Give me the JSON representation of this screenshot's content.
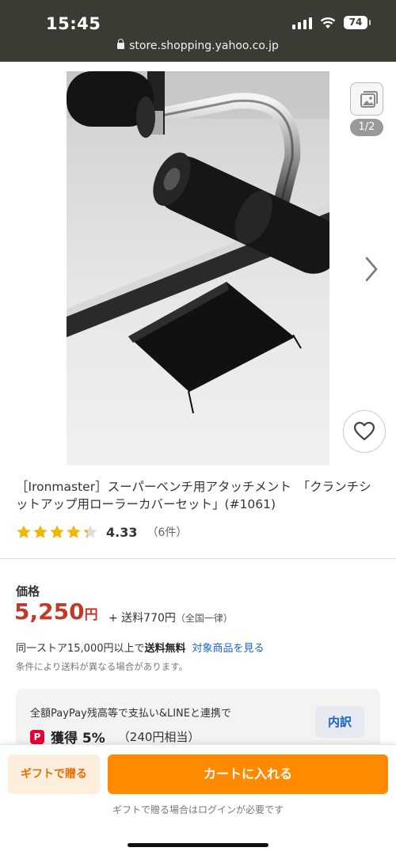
{
  "status": {
    "time": "15:45",
    "battery": "74"
  },
  "browser": {
    "url": "store.shopping.yahoo.co.jp"
  },
  "gallery": {
    "counter": "1/2"
  },
  "product": {
    "title": "［Ironmaster］スーパーベンチ用アタッチメント　「クランチシットアップ用ローラーカバーセット」(#1061)",
    "rating": {
      "score": "4.33",
      "count": "（6件）",
      "value": 4.33,
      "max": 5
    }
  },
  "price": {
    "label": "価格",
    "amount": "5,250",
    "currency": "円",
    "shipping": "+ 送料770円",
    "shipping_note": "（全国一律）"
  },
  "free_shipping": {
    "text": "同一ストア15,000円以上で",
    "bold": "送料無料",
    "link": "対象商品を見る",
    "note": "条件により送料が異なる場合があります。"
  },
  "paypay": {
    "text": "全額PayPay残高等で支払い&LINEと連携で",
    "logo": "P",
    "earn": "獲得 5%",
    "equiv": "（240円相当）",
    "detail_button": "内訳"
  },
  "actions": {
    "gift_button": "ギフトで贈る",
    "cart_button": "カートに入れる",
    "gift_note": "ギフトで贈る場合はログインが必要です"
  },
  "colors": {
    "price": "#c0392b",
    "cart": "#ff8a00",
    "link": "#1a61c9",
    "star": "#f5b400"
  },
  "icons": [
    "lock-icon",
    "gallery-icon",
    "chevron-right-icon",
    "heart-icon",
    "star-icon",
    "signal-icon",
    "wifi-icon",
    "battery-icon"
  ]
}
